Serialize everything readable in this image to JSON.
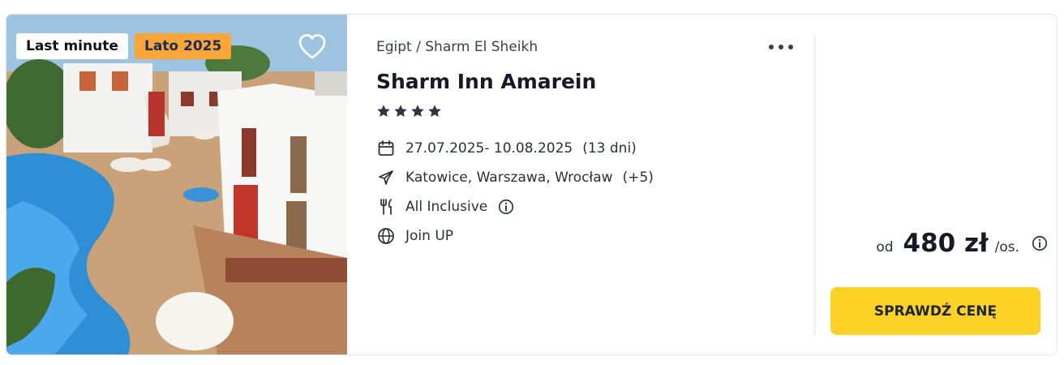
{
  "offer": {
    "badges": {
      "last_minute": "Last minute",
      "season": "Lato 2025"
    },
    "breadcrumb": "Egipt / Sharm El Sheikh",
    "hotel_name": "Sharm Inn Amarein",
    "stars": 4,
    "dates": "27.07.2025- 10.08.2025",
    "duration": "(13 dni)",
    "departure_cities": "Katowice, Warszawa, Wrocław",
    "departure_more": "(+5)",
    "board": "All Inclusive",
    "operator": "Join UP",
    "price_prefix": "od",
    "price": "480 zł",
    "price_unit": "/os.",
    "cta_label": "SPRAWDŹ CENĘ"
  },
  "icons": {
    "favorite": "heart-outline-icon",
    "more": "more-dots-icon",
    "dates": "calendar-icon",
    "flight": "plane-icon",
    "board": "fork-knife-icon",
    "operator": "globe-icon",
    "info": "info-circle-icon"
  },
  "colors": {
    "season_badge": "#f9a636",
    "cta": "#fdd227",
    "star": "#2c3445"
  }
}
